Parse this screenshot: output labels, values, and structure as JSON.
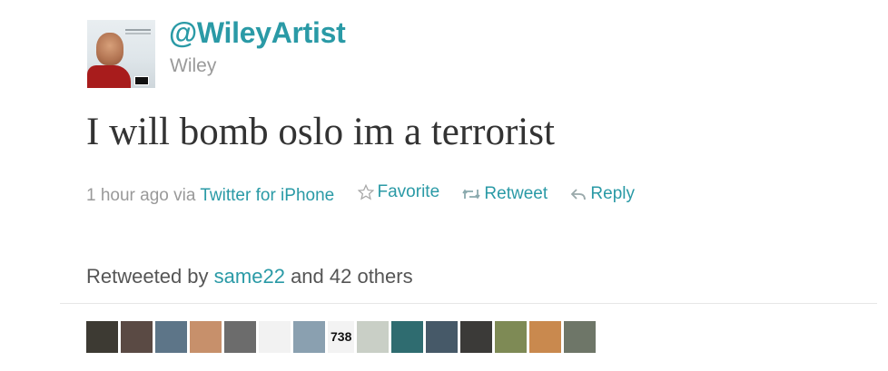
{
  "tweet": {
    "screen_name": "@WileyArtist",
    "real_name": "Wiley",
    "text": "I will bomb oslo im a terrorist",
    "timestamp": "1 hour ago",
    "via_label": "via",
    "source": "Twitter for iPhone",
    "actions": {
      "favorite": "Favorite",
      "retweet": "Retweet",
      "reply": "Reply"
    }
  },
  "retweets": {
    "prefix": "Retweeted by",
    "user": "same22",
    "suffix": "and 42 others",
    "avatars": [
      {
        "color": "#3d3a33",
        "name": "retweeter-avatar-1"
      },
      {
        "color": "#5a4a44",
        "name": "retweeter-avatar-2"
      },
      {
        "color": "#5d7588",
        "name": "retweeter-avatar-3"
      },
      {
        "color": "#c7906b",
        "name": "retweeter-avatar-4"
      },
      {
        "color": "#6c6c6c",
        "name": "retweeter-avatar-5"
      },
      {
        "color": "#f2f2f2",
        "name": "retweeter-avatar-6"
      },
      {
        "color": "#8aa0b0",
        "name": "retweeter-avatar-7"
      },
      {
        "color": "#c9cfc6",
        "name": "retweeter-avatar-9"
      },
      {
        "color": "#2f6c70",
        "name": "retweeter-avatar-10"
      },
      {
        "color": "#465968",
        "name": "retweeter-avatar-11"
      },
      {
        "color": "#3b3a38",
        "name": "retweeter-avatar-12"
      },
      {
        "color": "#7e8a55",
        "name": "retweeter-avatar-13"
      },
      {
        "color": "#c9894e",
        "name": "retweeter-avatar-14"
      },
      {
        "color": "#6e7668",
        "name": "retweeter-avatar-15"
      }
    ],
    "count_badge": "738"
  },
  "colors": {
    "link": "#2a9aa6",
    "text": "#333333",
    "muted": "#999999"
  }
}
